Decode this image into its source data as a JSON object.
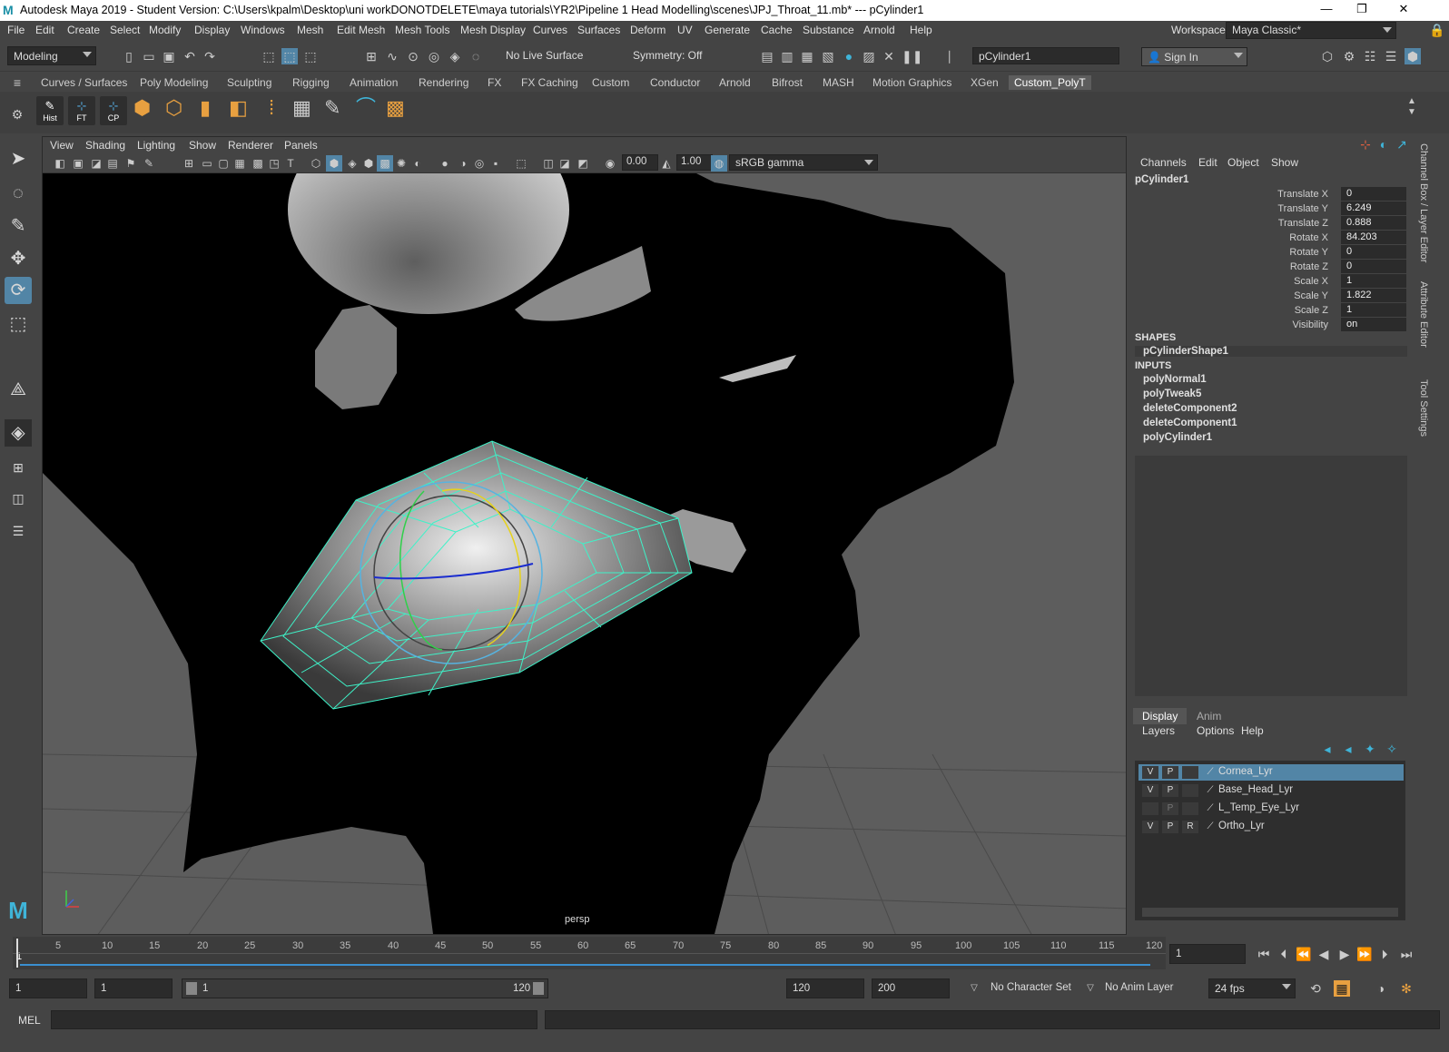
{
  "window": {
    "title": "Autodesk Maya 2019 - Student Version: C:\\Users\\kpalm\\Desktop\\uni workDONOTDELETE\\maya tutorials\\YR2\\Pipeline 1 Head Modelling\\scenes\\JPJ_Throat_11.mb*   ---   pCylinder1",
    "minimize": "—",
    "maximize": "❐",
    "close": "✕"
  },
  "menubar": {
    "items": [
      "File",
      "Edit",
      "Create",
      "Select",
      "Modify",
      "Display",
      "Windows",
      "Mesh",
      "Edit Mesh",
      "Mesh Tools",
      "Mesh Display",
      "Curves",
      "Surfaces",
      "Deform",
      "UV",
      "Generate",
      "Cache",
      "Substance",
      "Arnold",
      "Help"
    ],
    "workspace_label": "Workspace :",
    "workspace_value": "Maya Classic*"
  },
  "statusline": {
    "mode": "Modeling",
    "live_surface": "No Live Surface",
    "symmetry": "Symmetry: Off",
    "object_name": "pCylinder1",
    "sign_in": "Sign In"
  },
  "shelf": {
    "tabs": [
      "Curves / Surfaces",
      "Poly Modeling",
      "Sculpting",
      "Rigging",
      "Animation",
      "Rendering",
      "FX",
      "FX Caching",
      "Custom",
      "Conductor",
      "Arnold",
      "Bifrost",
      "MASH",
      "Motion Graphics",
      "XGen",
      "Custom_PolyT"
    ],
    "active_tab": "Custom_PolyT",
    "buttons": [
      "Hist",
      "FT",
      "CP"
    ]
  },
  "viewport": {
    "menu": [
      "View",
      "Shading",
      "Lighting",
      "Show",
      "Renderer",
      "Panels"
    ],
    "exposure": "0.00",
    "gamma": "1.00",
    "color_space": "sRGB gamma",
    "camera_label": "persp"
  },
  "channelbox": {
    "menu": [
      "Channels",
      "Edit",
      "Object",
      "Show"
    ],
    "object": "pCylinder1",
    "attributes": [
      {
        "label": "Translate X",
        "value": "0"
      },
      {
        "label": "Translate Y",
        "value": "6.249"
      },
      {
        "label": "Translate Z",
        "value": "0.888"
      },
      {
        "label": "Rotate X",
        "value": "84.203"
      },
      {
        "label": "Rotate Y",
        "value": "0"
      },
      {
        "label": "Rotate Z",
        "value": "0"
      },
      {
        "label": "Scale X",
        "value": "1"
      },
      {
        "label": "Scale Y",
        "value": "1.822"
      },
      {
        "label": "Scale Z",
        "value": "1"
      },
      {
        "label": "Visibility",
        "value": "on"
      }
    ],
    "shapes_header": "SHAPES",
    "shape": "pCylinderShape1",
    "inputs_header": "INPUTS",
    "inputs": [
      "polyNormal1",
      "polyTweak5",
      "deleteComponent2",
      "deleteComponent1",
      "polyCylinder1"
    ]
  },
  "side_tabs": [
    "Channel Box / Layer Editor",
    "Attribute Editor",
    "Tool Settings"
  ],
  "layers": {
    "tabs": [
      "Display",
      "Anim"
    ],
    "menu": [
      "Layers",
      "Options",
      "Help"
    ],
    "rows": [
      {
        "v": "V",
        "p": "P",
        "r": "",
        "name": "Cornea_Lyr",
        "selected": true
      },
      {
        "v": "V",
        "p": "P",
        "r": "",
        "name": "Base_Head_Lyr",
        "selected": false
      },
      {
        "v": "",
        "p": "P",
        "r": "",
        "name": "L_Temp_Eye_Lyr",
        "selected": false
      },
      {
        "v": "V",
        "p": "P",
        "r": "R",
        "name": "Ortho_Lyr",
        "selected": false
      }
    ]
  },
  "timeline": {
    "ticks": [
      "1",
      "5",
      "10",
      "15",
      "20",
      "25",
      "30",
      "35",
      "40",
      "45",
      "50",
      "55",
      "60",
      "65",
      "70",
      "75",
      "80",
      "85",
      "90",
      "95",
      "100",
      "105",
      "110",
      "115",
      "120"
    ],
    "current_frame": "1"
  },
  "range": {
    "start": "1",
    "playback_start": "1",
    "slider_start": "1",
    "slider_end": "120",
    "playback_end": "120",
    "end": "200",
    "character_set": "No Character Set",
    "anim_layer": "No Anim Layer",
    "fps": "24 fps"
  },
  "mel": {
    "label": "MEL"
  },
  "colors": {
    "accent": "#5285a6",
    "wire": "#3ef2c8",
    "bg": "#444444"
  }
}
